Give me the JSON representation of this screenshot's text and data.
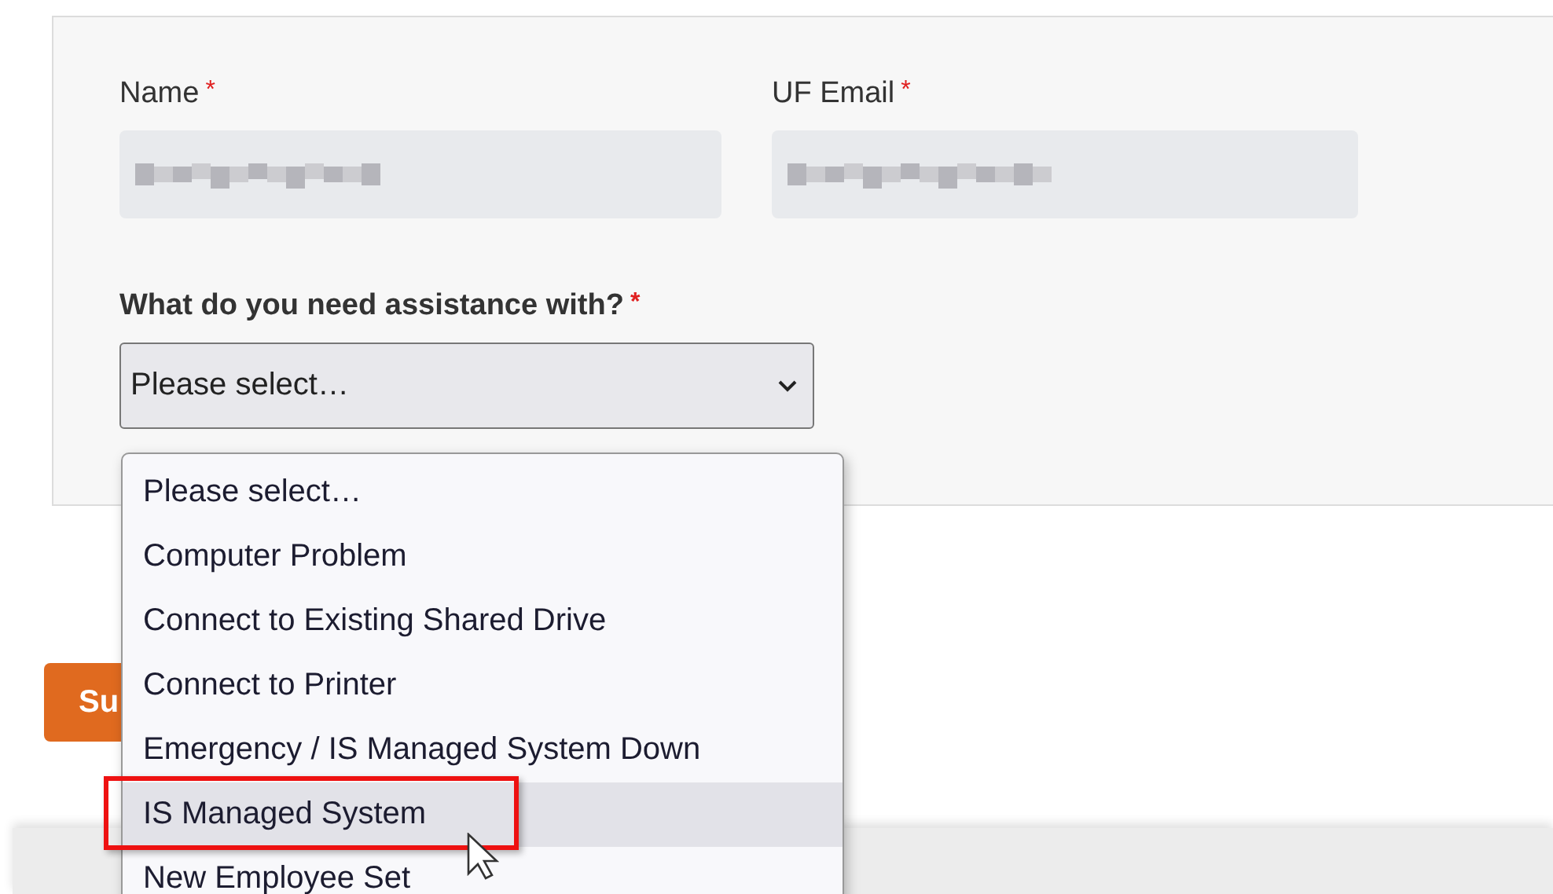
{
  "form": {
    "fields": [
      {
        "label": "Name",
        "required_mark": "*"
      },
      {
        "label": "UF Email",
        "required_mark": "*"
      }
    ],
    "question": {
      "label": "What do you need assistance with?",
      "required_mark": "*",
      "value": "Please select…"
    }
  },
  "dropdown": {
    "options": [
      {
        "label": "Please select…",
        "selected": false
      },
      {
        "label": "Computer Problem",
        "selected": false
      },
      {
        "label": "Connect to Existing Shared Drive",
        "selected": false
      },
      {
        "label": "Connect to Printer",
        "selected": false
      },
      {
        "label": "Emergency / IS Managed System Down",
        "selected": false
      },
      {
        "label": "IS Managed System",
        "selected": true
      },
      {
        "label": "New Employee Set",
        "selected": false
      }
    ]
  },
  "submit_button": {
    "label": "Su"
  }
}
